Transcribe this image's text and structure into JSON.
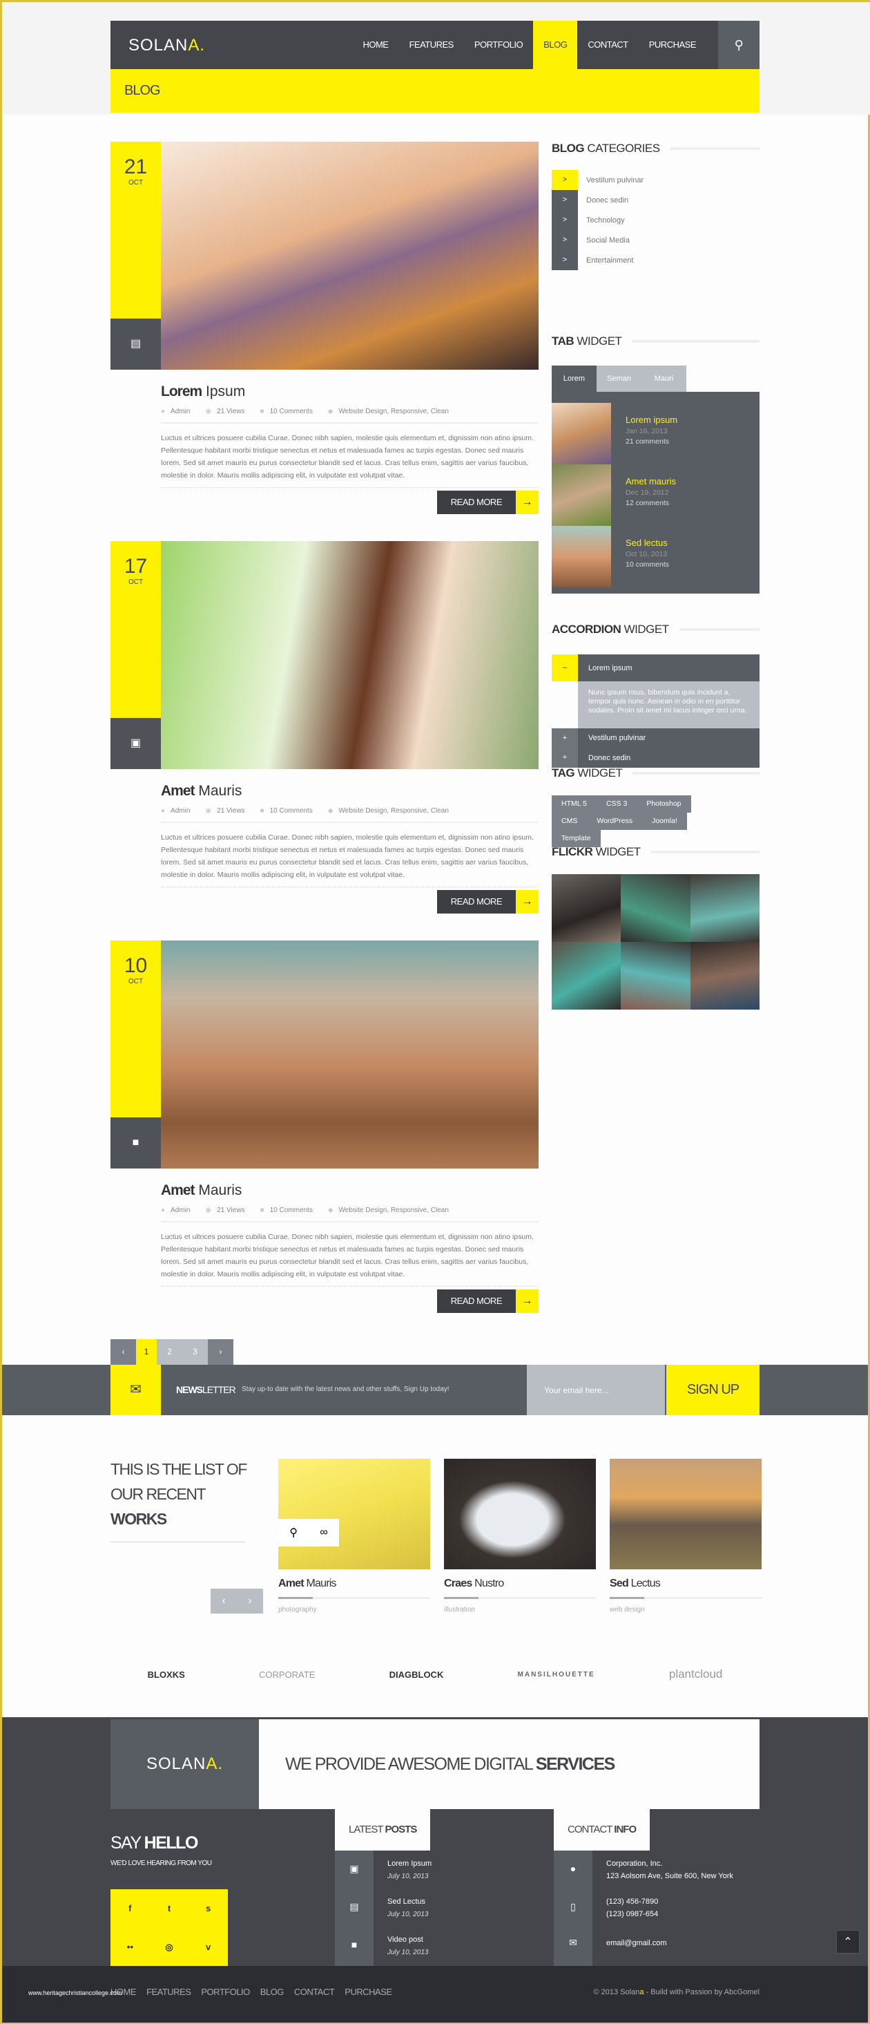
{
  "colors": {
    "accent": "#fff200",
    "dark": "#45464c",
    "gray": "#585c63",
    "light": "#b9bec4"
  },
  "header": {
    "logo_main": "SOLAN",
    "logo_accent": "A.",
    "nav": [
      "HOME",
      "FEATURES",
      "PORTFOLIO",
      "BLOG",
      "CONTACT",
      "PURCHASE"
    ],
    "active": "BLOG",
    "search_icon": "search-icon"
  },
  "page_title": "BLOG",
  "posts": [
    {
      "day": "21",
      "month": "OCT",
      "type_icon": "document-icon",
      "title_bold": "Lorem",
      "title_rest": "Ipsum",
      "author": "Admin",
      "views": "21 Views",
      "comments": "10 Comments",
      "tags": "Website Design,  Responsive, Clean",
      "text": "Luctus et ultrices posuere cubilia Curae. Donec nibh sapien, molestie quis elementum et, dignissim non atino ipsum. Pellentesque habitant morbi tristique senectus et netus et malesuada fames ac turpis egestas. Donec sed mauris lorem. Sed sit amet mauris eu purus consectetur blandit sed et lacus. Cras tellus enim, sagittis aer varius faucibus, molestie in dolor. Mauris mollis adipiscing elit, in vulputate est volutpat vitae.",
      "read_more": "READ MORE"
    },
    {
      "day": "17",
      "month": "OCT",
      "type_icon": "image-icon",
      "title_bold": "Amet",
      "title_rest": "Mauris",
      "author": "Admin",
      "views": "21 Views",
      "comments": "10 Comments",
      "tags": "Website Design,  Responsive, Clean",
      "text": "Luctus et ultrices posuere cubilia Curae. Donec nibh sapien, molestie quis elementum et, dignissim non atino ipsum. Pellentesque habitant morbi tristique senectus et netus et malesuada fames ac turpis egestas. Donec sed mauris lorem. Sed sit amet mauris eu purus consectetur blandit sed et lacus. Cras tellus enim, sagittis aer varius faucibus, molestie in dolor. Mauris mollis adipiscing elit, in vulputate est volutpat vitae.",
      "read_more": "READ MORE"
    },
    {
      "day": "10",
      "month": "OCT",
      "type_icon": "video-icon",
      "title_bold": "Amet",
      "title_rest": "Mauris",
      "author": "Admin",
      "views": "21 Views",
      "comments": "10 Comments",
      "tags": "Website Design,  Responsive, Clean",
      "text": "Luctus et ultrices posuere cubilia Curae. Donec nibh sapien, molestie quis elementum et, dignissim non atino ipsum. Pellentesque habitant morbi tristique senectus et netus et malesuada fames ac turpis egestas. Donec sed mauris lorem. Sed sit amet mauris eu purus consectetur blandit sed et lacus. Cras tellus enim, sagittis aer varius faucibus, molestie in dolor. Mauris mollis adipiscing elit, in vulputate est volutpat vitae.",
      "read_more": "READ MORE"
    }
  ],
  "sidebar": {
    "categories": {
      "h_bold": "BLOG",
      "h_rest": "CATEGORIES",
      "items": [
        "Vestilum pulvinar",
        "Donec sedin",
        "Technology",
        "Social Media",
        "Entertainment"
      ]
    },
    "tabs": {
      "h_bold": "TAB",
      "h_rest": "WIDGET",
      "tabs": [
        "Lorem",
        "Seman",
        "Mauri"
      ],
      "items": [
        {
          "title": "Lorem ipsum",
          "date": "Jan 16, 2013",
          "comments": "21 comments"
        },
        {
          "title": "Amet  mauris",
          "date": "Dec 19, 2012",
          "comments": "12 comments"
        },
        {
          "title": "Sed lectus",
          "date": "Oct 10, 2013",
          "comments": "10 comments"
        }
      ]
    },
    "accordion": {
      "h_bold": "ACCORDION",
      "h_rest": "WIDGET",
      "open_title": "Lorem ipsum",
      "open_body": "Nunc ipsum risus, bibendum quis incidunt a, tempor quis nunc. Aenean in odio in en porttitor sodales. Proin sit amet mi lacus integer orci urna.",
      "closed": [
        "Vestilum pulvinar",
        "Donec sedin"
      ]
    },
    "tags": {
      "h_bold": "TAG",
      "h_rest": "WIDGET",
      "items": [
        "HTML 5",
        "CSS 3",
        "Photoshop",
        "CMS",
        "WordPress",
        "Joomla!",
        "Template"
      ]
    },
    "flickr": {
      "h_bold": "FLICKR",
      "h_rest": "WIDGET"
    }
  },
  "pagination": {
    "pages": [
      "1",
      "2",
      "3"
    ],
    "current": "1"
  },
  "newsletter": {
    "title_bold": "NEWS",
    "title_rest": "LETTER",
    "text": "Stay up-to date with the latest news and other stuffs, Sign Up today!",
    "placeholder": "Your email here...",
    "button": "SIGN UP"
  },
  "works": {
    "heading_1": "THIS IS THE LIST OF",
    "heading_2": "OUR RECENT",
    "heading_bold": "WORKS",
    "items": [
      {
        "bold": "Amet",
        "rest": "Mauris",
        "category": "photography"
      },
      {
        "bold": "Craes",
        "rest": "Nustro",
        "category": "illustration"
      },
      {
        "bold": "Sed",
        "rest": "Lectus",
        "category": "web design"
      }
    ]
  },
  "clients": [
    "BLOXKS",
    "CORPORATE",
    "DIAGBLOCK",
    "MANSILHOUETTE",
    "plantcloud"
  ],
  "footer": {
    "logo_main": "SOLAN",
    "logo_accent": "A.",
    "tagline": "WE PROVIDE AWESOME DIGITAL",
    "tagline_bold": "SERVICES",
    "say": "SAY",
    "say_bold": "HELLO",
    "say_sub": "WE'D LOVE HEARING FROM YOU",
    "social": [
      "f",
      "t",
      "s",
      "••",
      "◎",
      "v"
    ],
    "latest_h": "LATEST",
    "latest_h_bold": "POSTS",
    "latest": [
      {
        "title": "Lorem Ipsum",
        "date": "July 10, 2013"
      },
      {
        "title": "Sed Lectus",
        "date": "July 10, 2013"
      },
      {
        "title": "Video post",
        "date": "July 10, 2013"
      }
    ],
    "contact_h": "CONTACT",
    "contact_h_bold": "INFO",
    "contact": {
      "company": "Corporation, Inc.",
      "address": "123 Aolsom Ave, Suite 600, New York",
      "phone1": "(123) 456-7890",
      "phone2": "(123) 0987-654",
      "email": "email@gmail.com"
    },
    "nav": [
      "HOME",
      "FEATURES",
      "PORTFOLIO",
      "BLOG",
      "CONTACT",
      "PURCHASE"
    ],
    "copy_pre": "© 2013 Solan",
    "copy_accent": "a",
    "copy_post": "  -  Build with Passion by AbcGomel",
    "watermark": "www.heritagechristiancollege.com"
  }
}
